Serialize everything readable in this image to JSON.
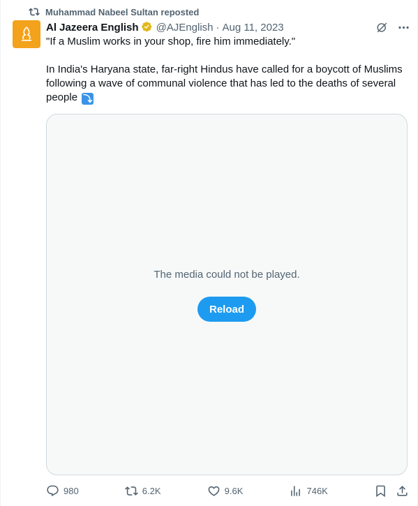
{
  "repost": {
    "text": "Muhammad Nabeel Sultan reposted"
  },
  "author": {
    "name": "Al Jazeera English",
    "handle": "@AJEnglish",
    "separator": "·",
    "date": "Aug 11, 2023",
    "avatar_color": "#f3a21b",
    "verified_color": "#e2b719"
  },
  "tweet": {
    "line1": "\"If a Muslim works in your shop, fire him immediately.\"",
    "line2": "In India's Haryana state, far-right Hindus have called for a boycott of Muslims following a wave of communal violence that has led to the deaths of several people",
    "emoji_glyph": "⤵"
  },
  "media": {
    "message": "The media could not be played.",
    "reload_label": "Reload"
  },
  "actions": {
    "replies": "980",
    "reposts": "6.2K",
    "likes": "9.6K",
    "views": "746K"
  },
  "icons": {
    "repost_header": "repost-icon",
    "grok": "grok-icon",
    "more": "more-icon",
    "reply": "reply-icon",
    "repost": "repost-icon",
    "like": "heart-icon",
    "views": "views-icon",
    "bookmark": "bookmark-icon",
    "share": "share-icon"
  },
  "colors": {
    "accent": "#1d9bf0",
    "muted_text": "#536471",
    "text": "#0f1419"
  }
}
